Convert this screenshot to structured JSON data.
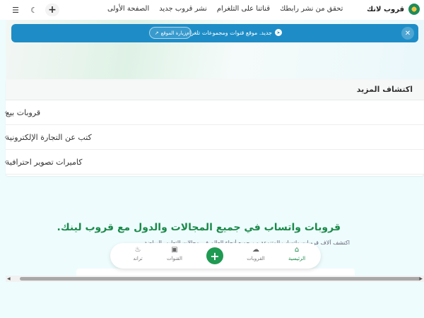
{
  "nav": {
    "brand": "قروب لانك",
    "links": [
      "الصفحة الأولى",
      "نشر قروب جديد",
      "قناتنا على التلغرام",
      "تحقق من نشر رابطك"
    ],
    "add_symbol": "+",
    "theme_symbol": "☾",
    "menu_symbol": "☰"
  },
  "announcement": {
    "text": "جديد. موقع قنوات ومجموعات تلغرام",
    "button": "زيارة الموقع",
    "close_symbol": "✕",
    "color": "#1e8dc7"
  },
  "explore": {
    "header": "اكتشاف المزيد",
    "items": [
      "قروبات بيع",
      "كتب عن التجارة الإلكترونية",
      "كاميرات تصوير احترافية"
    ]
  },
  "main": {
    "title": "قروبات واتساب في جميع المجالات والدول مع قروب لينك.",
    "subtitle": "اكتشف آلاف قروبات واتساب المتنوعة من جميع أنحاء العالم في مجالات التعليم، الرياضة،"
  },
  "bottom_nav": {
    "items": [
      {
        "label": "الرئيسية",
        "icon": "home-icon"
      },
      {
        "label": "القروبات",
        "icon": "chat-icon"
      },
      {
        "label": "القنوات",
        "icon": "rss-icon"
      },
      {
        "label": "تراند",
        "icon": "fire-icon"
      }
    ]
  },
  "colors": {
    "accent_green": "#1b8a4a",
    "announcement_blue": "#1e8dc7"
  }
}
